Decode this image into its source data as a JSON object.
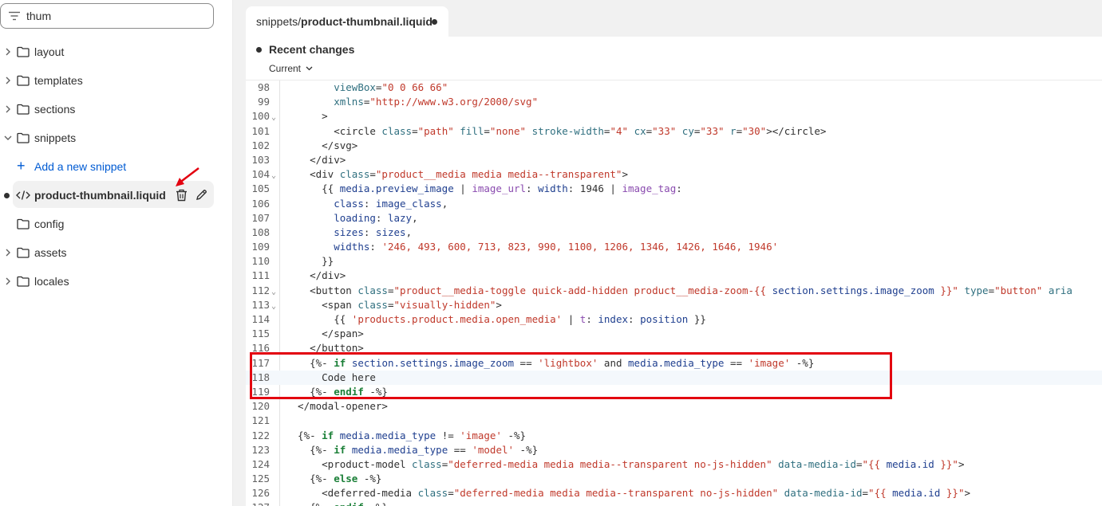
{
  "sidebar": {
    "search_value": "thum",
    "items": [
      {
        "label": "layout",
        "type": "folder",
        "expanded": false
      },
      {
        "label": "templates",
        "type": "folder",
        "expanded": false
      },
      {
        "label": "sections",
        "type": "folder",
        "expanded": false
      },
      {
        "label": "snippets",
        "type": "folder",
        "expanded": true
      },
      {
        "label": "Add a new snippet",
        "type": "action"
      },
      {
        "label": "product-thumbnail.liquid",
        "type": "file",
        "selected": true
      },
      {
        "label": "config",
        "type": "folder",
        "expanded": false
      },
      {
        "label": "assets",
        "type": "folder",
        "expanded": false
      },
      {
        "label": "locales",
        "type": "folder",
        "expanded": false
      }
    ]
  },
  "tab": {
    "path_prefix": "snippets/",
    "file_name": "product-thumbnail.liquid"
  },
  "toolbar": {
    "recent_changes": "Recent changes",
    "version": "Current"
  },
  "code": {
    "lines": [
      {
        "n": "98",
        "fold": false,
        "html": "        <span class=\"attr\">viewBox</span>=<span class=\"str\">\"0 0 66 66\"</span>"
      },
      {
        "n": "99",
        "fold": false,
        "html": "        <span class=\"attr\">xmlns</span>=<span class=\"str\">\"http://www.w3.org/2000/svg\"</span>"
      },
      {
        "n": "100",
        "fold": true,
        "html": "      &gt;"
      },
      {
        "n": "101",
        "fold": false,
        "html": "        &lt;circle <span class=\"attr\">class</span>=<span class=\"str\">\"path\"</span> <span class=\"attr\">fill</span>=<span class=\"str\">\"none\"</span> <span class=\"attr\">stroke-width</span>=<span class=\"str\">\"4\"</span> <span class=\"attr\">cx</span>=<span class=\"str\">\"33\"</span> <span class=\"attr\">cy</span>=<span class=\"str\">\"33\"</span> <span class=\"attr\">r</span>=<span class=\"str\">\"30\"</span>&gt;&lt;/circle&gt;"
      },
      {
        "n": "102",
        "fold": false,
        "html": "      &lt;/svg&gt;"
      },
      {
        "n": "103",
        "fold": false,
        "html": "    &lt;/div&gt;"
      },
      {
        "n": "104",
        "fold": true,
        "html": "    &lt;div <span class=\"attr\">class</span>=<span class=\"str\">\"product__media media media--transparent\"</span>&gt;"
      },
      {
        "n": "105",
        "fold": false,
        "html": "      {{ <span class=\"var\">media.preview_image</span> | <span class=\"filt\">image_url</span>: <span class=\"var\">width</span>: 1946 | <span class=\"filt\">image_tag</span>:"
      },
      {
        "n": "106",
        "fold": false,
        "html": "        <span class=\"var\">class</span>: <span class=\"var\">image_class</span>,"
      },
      {
        "n": "107",
        "fold": false,
        "html": "        <span class=\"var\">loading</span>: <span class=\"var\">lazy</span>,"
      },
      {
        "n": "108",
        "fold": false,
        "html": "        <span class=\"var\">sizes</span>: <span class=\"var\">sizes</span>,"
      },
      {
        "n": "109",
        "fold": false,
        "html": "        <span class=\"var\">widths</span>: <span class=\"str\">'246, 493, 600, 713, 823, 990, 1100, 1206, 1346, 1426, 1646, 1946'</span>"
      },
      {
        "n": "110",
        "fold": false,
        "html": "      }}"
      },
      {
        "n": "111",
        "fold": false,
        "html": "    &lt;/div&gt;"
      },
      {
        "n": "112",
        "fold": true,
        "html": "    &lt;button <span class=\"attr\">class</span>=<span class=\"str\">\"product__media-toggle quick-add-hidden product__media-zoom-{{ <span class=\"var\">section.settings.image_zoom</span> }}\"</span> <span class=\"attr\">type</span>=<span class=\"str\">\"button\"</span> <span class=\"attr\">aria</span>"
      },
      {
        "n": "113",
        "fold": true,
        "html": "      &lt;span <span class=\"attr\">class</span>=<span class=\"str\">\"visually-hidden\"</span>&gt;"
      },
      {
        "n": "114",
        "fold": false,
        "html": "        {{ <span class=\"str\">'products.product.media.open_media'</span> | <span class=\"filt\">t</span>: <span class=\"var\">index</span>: <span class=\"var\">position</span> }}"
      },
      {
        "n": "115",
        "fold": false,
        "html": "      &lt;/span&gt;"
      },
      {
        "n": "116",
        "fold": false,
        "html": "    &lt;/button&gt;"
      },
      {
        "n": "117",
        "fold": false,
        "html": "    {%- <span class=\"kw\">if</span> <span class=\"var\">section.settings.image_zoom</span> == <span class=\"str\">'lightbox'</span> and <span class=\"var\">media.media_type</span> == <span class=\"str\">'image'</span> -%}"
      },
      {
        "n": "118",
        "fold": false,
        "active": true,
        "html": "      Code here"
      },
      {
        "n": "119",
        "fold": false,
        "html": "    {%- <span class=\"kw\">endif</span> -%}"
      },
      {
        "n": "120",
        "fold": false,
        "html": "  &lt;/modal-opener&gt;"
      },
      {
        "n": "121",
        "fold": false,
        "html": ""
      },
      {
        "n": "122",
        "fold": false,
        "html": "  {%- <span class=\"kw\">if</span> <span class=\"var\">media.media_type</span> != <span class=\"str\">'image'</span> -%}"
      },
      {
        "n": "123",
        "fold": false,
        "html": "    {%- <span class=\"kw\">if</span> <span class=\"var\">media.media_type</span> == <span class=\"str\">'model'</span> -%}"
      },
      {
        "n": "124",
        "fold": false,
        "html": "      &lt;product-model <span class=\"attr\">class</span>=<span class=\"str\">\"deferred-media media media--transparent no-js-hidden\"</span> <span class=\"attr\">data-media-id</span>=<span class=\"str\">\"{{ <span class=\"var\">media.id</span> }}\"</span>&gt;"
      },
      {
        "n": "125",
        "fold": false,
        "html": "    {%- <span class=\"kw\">else</span> -%}"
      },
      {
        "n": "126",
        "fold": false,
        "html": "      &lt;deferred-media <span class=\"attr\">class</span>=<span class=\"str\">\"deferred-media media media--transparent no-js-hidden\"</span> <span class=\"attr\">data-media-id</span>=<span class=\"str\">\"{{ <span class=\"var\">media.id</span> }}\"</span>&gt;"
      },
      {
        "n": "127",
        "fold": false,
        "html": "    {%- <span class=\"kw\">endif</span> -%}"
      }
    ]
  },
  "colors": {
    "accent_link": "#005bd3",
    "annotation_red": "#e3000f"
  },
  "icons": {
    "filter": "filter-icon",
    "folder": "folder-icon",
    "chevron": "chevron-right-icon",
    "code_file": "code-icon",
    "trash": "trash-icon",
    "pencil": "pencil-icon"
  }
}
